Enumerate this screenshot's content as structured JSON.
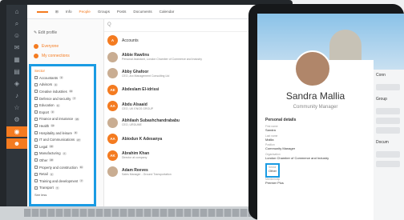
{
  "nav": {
    "tabs": [
      "Info",
      "People",
      "Groups",
      "Posts",
      "Documents",
      "Calendar"
    ]
  },
  "sidebar": {
    "edit_profile": "Edit profile",
    "everyone": "Everyone",
    "connections": "My connections"
  },
  "filter": {
    "section": "Sector",
    "rows": [
      {
        "label": "Accountants",
        "count": "3"
      },
      {
        "label": "Advisors",
        "count": "4"
      },
      {
        "label": "Creative industries",
        "count": "13"
      },
      {
        "label": "Defence and security",
        "count": "7"
      },
      {
        "label": "Education",
        "count": "6"
      },
      {
        "label": "Export",
        "count": "3"
      },
      {
        "label": "Finance and insurance",
        "count": "15"
      },
      {
        "label": "Health",
        "count": "10"
      },
      {
        "label": "Hospitality and leisure",
        "count": "8"
      },
      {
        "label": "IT and Communications",
        "count": "27"
      },
      {
        "label": "Legal",
        "count": "19"
      },
      {
        "label": "Manufacturing",
        "count": "7"
      },
      {
        "label": "Other",
        "count": "18"
      },
      {
        "label": "Property and construction",
        "count": "11"
      },
      {
        "label": "Retail",
        "count": "1"
      },
      {
        "label": "Training and development",
        "count": "7"
      },
      {
        "label": "Transport",
        "count": "7"
      }
    ],
    "more": "See less"
  },
  "search": {
    "placeholder": "Q"
  },
  "list": {
    "accounts": "Accounts",
    "people": [
      {
        "initials": "",
        "name": "Abbie Rawlins",
        "sub": "Personal Assistant, London Chamber of Commerce and Industry"
      },
      {
        "initials": "",
        "name": "Abby Ghafoor",
        "sub": "CEO, Arc Management Consulting Ltd"
      },
      {
        "initials": "AE",
        "name": "Abdeslam El-idrissi",
        "sub": ""
      },
      {
        "initials": "AA",
        "name": "Abdu Alsaaid",
        "sub": "CEO, UK ENGS GROUP"
      },
      {
        "initials": "",
        "name": "Abhilash Subashchandrababu",
        "sub": "CEO, URDUME"
      },
      {
        "initials": "AA",
        "name": "Abiodun K Adesanya",
        "sub": ""
      },
      {
        "initials": "AK",
        "name": "Abrahim Khan",
        "sub": "Director at company"
      },
      {
        "initials": "",
        "name": "Adam Reeves",
        "sub": "Sales Manager - Ground Transportation"
      }
    ]
  },
  "profile": {
    "name": "Sandra Mallia",
    "role": "Community Manager",
    "section": "Personal details",
    "fields": [
      {
        "label": "First name",
        "value": "Sandra"
      },
      {
        "label": "Last name",
        "value": "Mallia"
      },
      {
        "label": "Position",
        "value": "Community Manager"
      },
      {
        "label": "Organisation",
        "value": "London Chamber of Commerce and Industry"
      },
      {
        "label": "Sector",
        "value": "Other"
      },
      {
        "label": "Membership",
        "value": "Premier Plus"
      }
    ]
  },
  "right": {
    "s1": "Conn",
    "s2": "Group",
    "s3": "Docum"
  }
}
